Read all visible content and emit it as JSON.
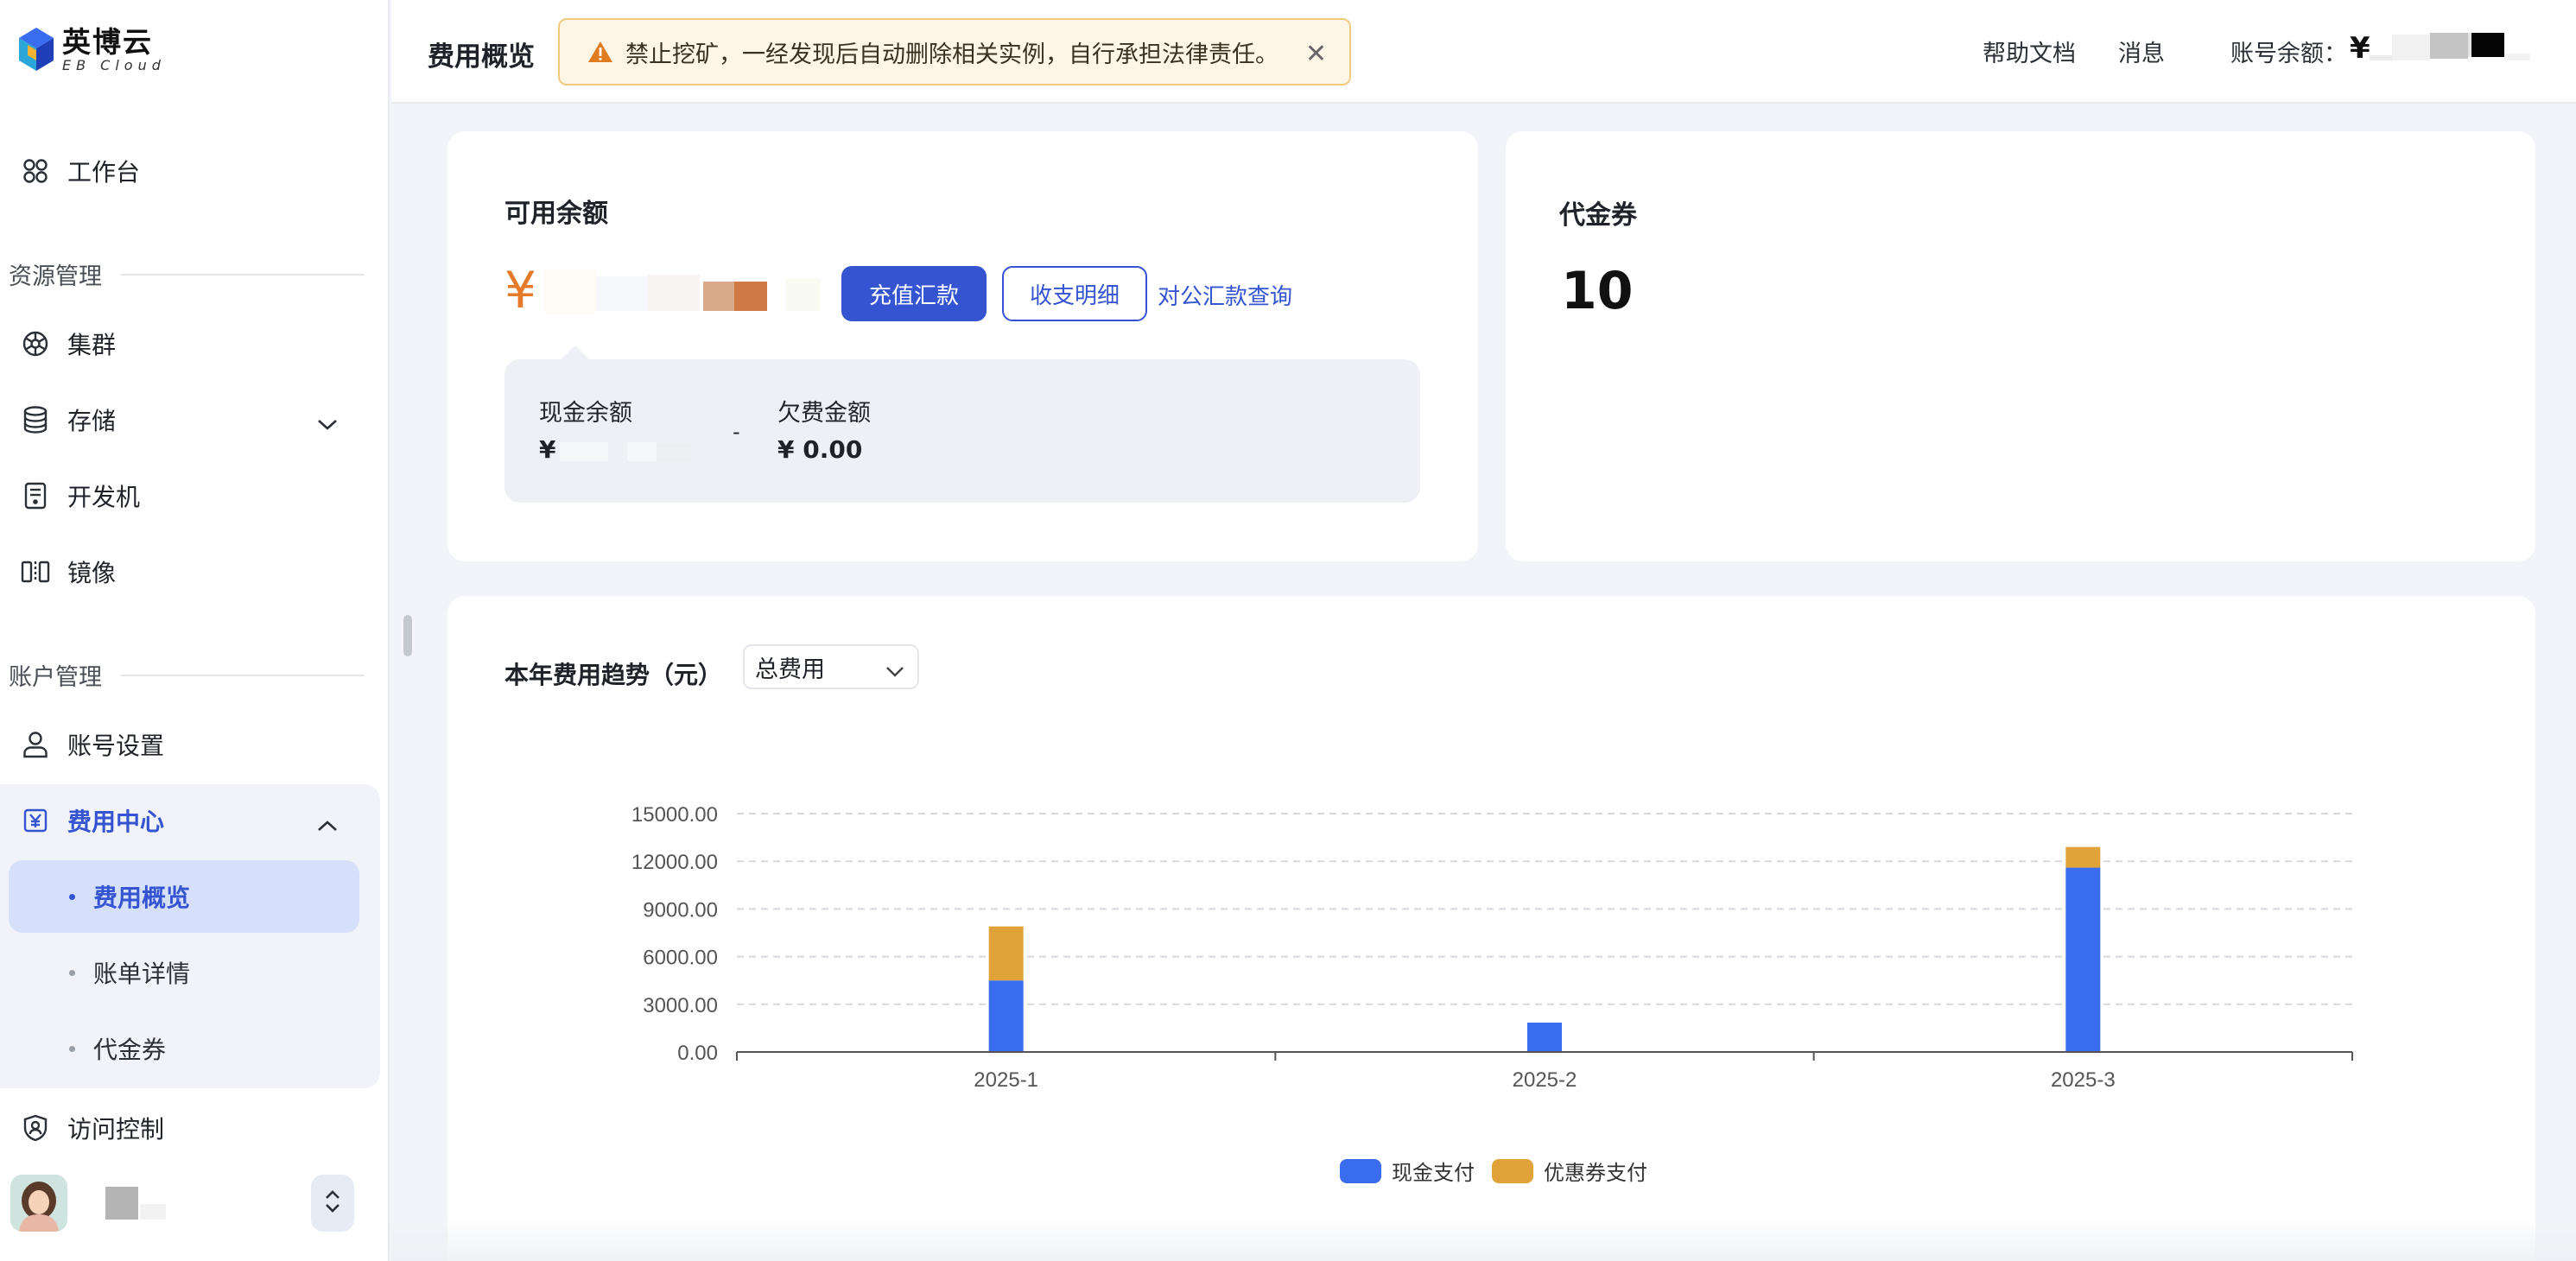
{
  "brand": {
    "name_cn": "英博云",
    "name_en": "EB Cloud"
  },
  "sidebar": {
    "workbench": "工作台",
    "resource_section": "资源管理",
    "resources": [
      {
        "label": "集群",
        "icon": "cluster-icon"
      },
      {
        "label": "存储",
        "icon": "database-icon"
      },
      {
        "label": "开发机",
        "icon": "devmachine-icon"
      },
      {
        "label": "镜像",
        "icon": "image-icon"
      }
    ],
    "account_section": "账户管理",
    "account_settings": "账号设置",
    "fee_center": "费用中心",
    "fee_sub": [
      "费用概览",
      "账单详情",
      "代金券"
    ],
    "access_control": "访问控制"
  },
  "header": {
    "title": "费用概览",
    "alert": "禁止挖矿，一经发现后自动删除相关实例，自行承担法律责任。",
    "help_docs": "帮助文档",
    "messages": "消息",
    "balance_label": "账号余额：",
    "currency": "¥"
  },
  "balance_card": {
    "title": "可用余额",
    "currency": "¥",
    "recharge_button": "充值汇款",
    "detail_button": "收支明细",
    "corporate_link": "对公汇款查询",
    "cash_balance_label": "现金余额",
    "cash_balance_prefix": "¥",
    "separator": "-",
    "arrears_label": "欠费金额",
    "arrears_value": "¥ 0.00"
  },
  "voucher_card": {
    "title": "代金券",
    "value": "10"
  },
  "trend": {
    "label": "本年费用趋势（元）",
    "select_value": "总费用"
  },
  "colors": {
    "accent": "#3454d1",
    "cash": "#3a6cf0",
    "coupon": "#e0a33a",
    "yen": "#e57a2a"
  },
  "chart_data": {
    "type": "bar",
    "stacked": true,
    "categories": [
      "2025-1",
      "2025-2",
      "2025-3"
    ],
    "series": [
      {
        "name": "现金支付",
        "color": "#3a6cf0",
        "values": [
          4500,
          1850,
          11600
        ]
      },
      {
        "name": "优惠券支付",
        "color": "#e0a33a",
        "values": [
          3400,
          0,
          1300
        ]
      }
    ],
    "yticks": [
      "0.00",
      "3000.00",
      "6000.00",
      "9000.00",
      "12000.00",
      "15000.00"
    ],
    "ylim": [
      0,
      15000
    ],
    "grid": true,
    "legend_position": "bottom-center"
  }
}
